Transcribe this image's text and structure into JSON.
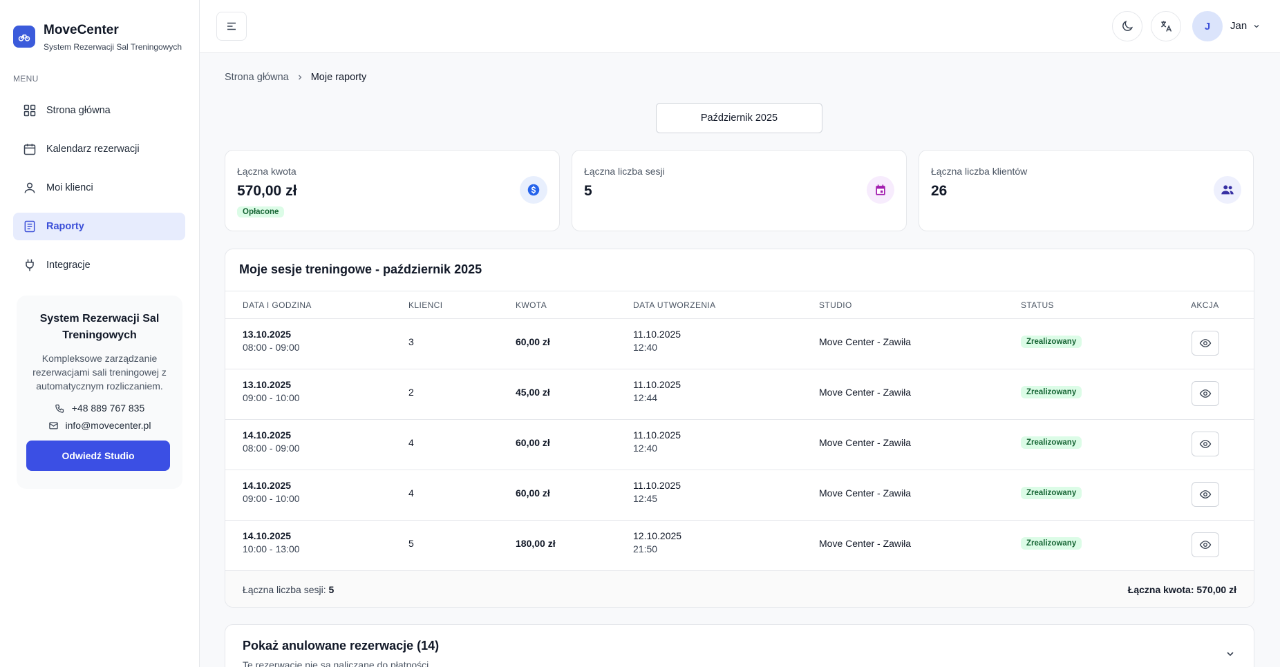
{
  "brand": {
    "name": "MoveCenter",
    "subtitle": "System Rezerwacji Sal Treningowych"
  },
  "menu_label": "MENU",
  "nav": [
    {
      "label": "Strona główna",
      "icon": "grid-icon"
    },
    {
      "label": "Kalendarz rezerwacji",
      "icon": "calendar-icon"
    },
    {
      "label": "Moi klienci",
      "icon": "user-icon"
    },
    {
      "label": "Raporty",
      "icon": "report-icon",
      "active": true
    },
    {
      "label": "Integracje",
      "icon": "plug-icon"
    }
  ],
  "promo": {
    "title": "System Rezerwacji Sal Treningowych",
    "description": "Kompleksowe zarządzanie rezerwacjami sali treningowej z automatycznym rozliczaniem.",
    "phone": "+48 889 767 835",
    "email": "info@movecenter.pl",
    "button": "Odwiedź Studio"
  },
  "header": {
    "avatar_initial": "J",
    "user_name": "Jan"
  },
  "breadcrumb": {
    "home": "Strona główna",
    "current": "Moje raporty"
  },
  "month_selector": "Październik 2025",
  "stats": {
    "amount": {
      "label": "Łączna kwota",
      "value": "570,00 zł",
      "badge": "Opłacone"
    },
    "sessions": {
      "label": "Łączna liczba sesji",
      "value": "5"
    },
    "clients": {
      "label": "Łączna liczba klientów",
      "value": "26"
    }
  },
  "table": {
    "title": "Moje sesje treningowe - październik 2025",
    "headers": [
      "DATA I GODZINA",
      "KLIENCI",
      "KWOTA",
      "DATA UTWORZENIA",
      "STUDIO",
      "STATUS",
      "AKCJA"
    ],
    "rows": [
      {
        "date": "13.10.2025",
        "time": "08:00 - 09:00",
        "clients": "3",
        "amount": "60,00 zł",
        "created_date": "11.10.2025",
        "created_time": "12:40",
        "studio": "Move Center - Zawiła",
        "status": "Zrealizowany"
      },
      {
        "date": "13.10.2025",
        "time": "09:00 - 10:00",
        "clients": "2",
        "amount": "45,00 zł",
        "created_date": "11.10.2025",
        "created_time": "12:44",
        "studio": "Move Center - Zawiła",
        "status": "Zrealizowany"
      },
      {
        "date": "14.10.2025",
        "time": "08:00 - 09:00",
        "clients": "4",
        "amount": "60,00 zł",
        "created_date": "11.10.2025",
        "created_time": "12:40",
        "studio": "Move Center - Zawiła",
        "status": "Zrealizowany"
      },
      {
        "date": "14.10.2025",
        "time": "09:00 - 10:00",
        "clients": "4",
        "amount": "60,00 zł",
        "created_date": "11.10.2025",
        "created_time": "12:45",
        "studio": "Move Center - Zawiła",
        "status": "Zrealizowany"
      },
      {
        "date": "14.10.2025",
        "time": "10:00 - 13:00",
        "clients": "5",
        "amount": "180,00 zł",
        "created_date": "12.10.2025",
        "created_time": "21:50",
        "studio": "Move Center - Zawiła",
        "status": "Zrealizowany"
      }
    ],
    "footer": {
      "sessions_label": "Łączna liczba sesji:",
      "sessions_value": "5",
      "amount_label": "Łączna kwota:",
      "amount_value": "570,00 zł"
    }
  },
  "cancelled": {
    "title": "Pokaż anulowane rezerwacje (14)",
    "subtitle": "Te rezerwacje nie są naliczane do płatności"
  },
  "colors": {
    "accent": "#3b4fe4",
    "active_bg": "#e7ecfd",
    "success_bg": "#dcfce7",
    "success_text": "#166534"
  }
}
